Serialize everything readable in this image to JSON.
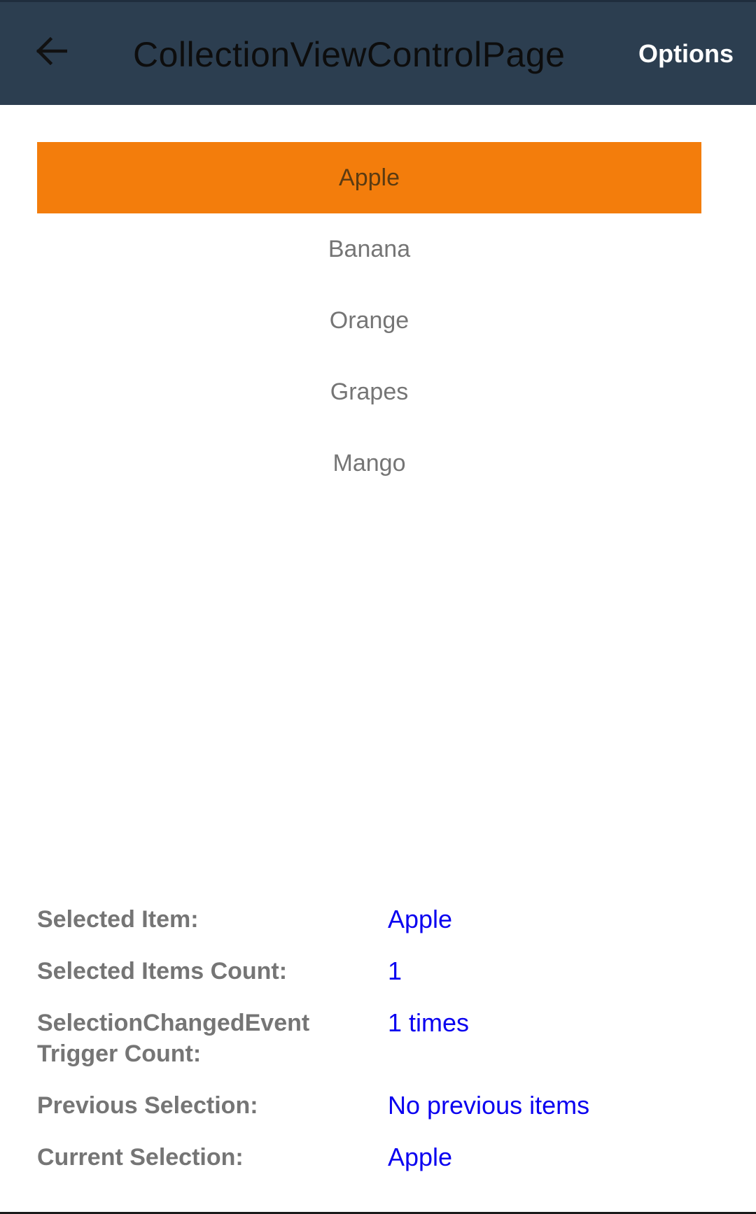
{
  "header": {
    "title": "CollectionViewControlPage",
    "options_label": "Options",
    "back_icon": "arrow-left-icon"
  },
  "collection": {
    "items": [
      {
        "label": "Apple",
        "selected": true
      },
      {
        "label": "Banana",
        "selected": false
      },
      {
        "label": "Orange",
        "selected": false
      },
      {
        "label": "Grapes",
        "selected": false
      },
      {
        "label": "Mango",
        "selected": false
      }
    ]
  },
  "info": {
    "selected_item": {
      "label": "Selected Item:",
      "value": "Apple"
    },
    "selected_count": {
      "label": "Selected Items Count:",
      "value": "1"
    },
    "trigger_count": {
      "label": "SelectionChangedEvent\nTrigger Count:",
      "value": "1 times"
    },
    "previous_selection": {
      "label": "Previous Selection:",
      "value": "No previous items"
    },
    "current_selection": {
      "label": "Current Selection:",
      "value": "Apple"
    }
  },
  "colors": {
    "app_bar": "#2c3e50",
    "selected_item": "#f37d0c",
    "value_text": "#0a00f0",
    "label_text": "#757575"
  }
}
